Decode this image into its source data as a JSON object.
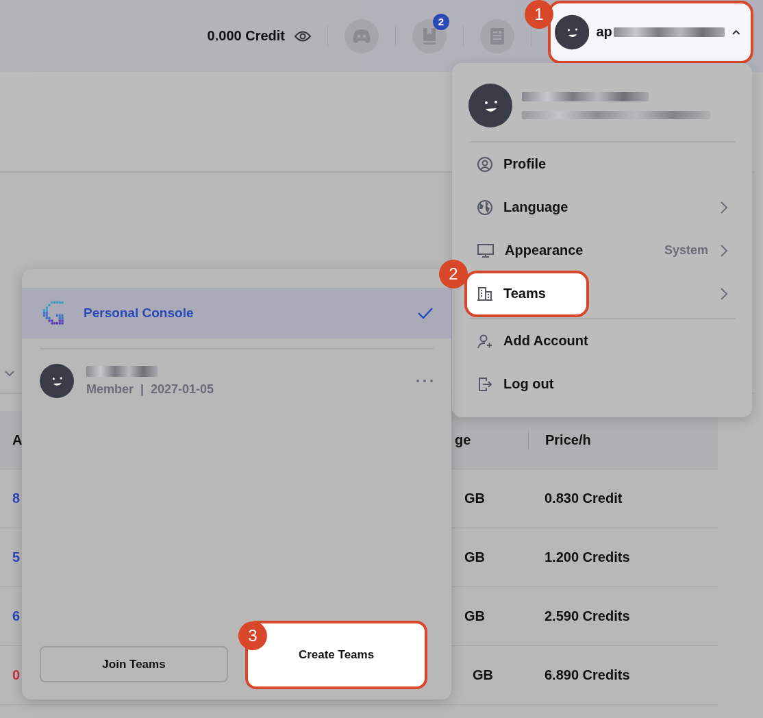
{
  "header": {
    "credit": "0.000 Credit",
    "notification_badge": "2"
  },
  "user_button": {
    "name": "ap",
    "expanded": true,
    "highlighted": true,
    "callout": "1"
  },
  "account_menu": {
    "items": [
      {
        "label": "Profile",
        "submenu": false,
        "highlighted": false,
        "divider_before": false
      },
      {
        "label": "Language",
        "submenu": true,
        "highlighted": false,
        "divider_before": false
      },
      {
        "label": "Appearance",
        "value": "System",
        "submenu": true,
        "highlighted": false,
        "divider_before": false
      },
      {
        "label": "Teams",
        "submenu": true,
        "highlighted": true,
        "callout": "2",
        "divider_before": false
      },
      {
        "label": "Add Account",
        "submenu": false,
        "highlighted": false,
        "divider_before": true
      },
      {
        "label": "Log out",
        "submenu": false,
        "highlighted": false,
        "divider_before": false
      }
    ]
  },
  "teams_panel": {
    "teams": [
      {
        "kind": "console",
        "name": "Personal Console",
        "selected": true
      },
      {
        "kind": "member",
        "subtitle": "Member  |  2027-01-05",
        "selected": false
      }
    ],
    "buttons": [
      {
        "label": "Join Teams",
        "highlighted": false
      },
      {
        "label": "Create Teams",
        "highlighted": true,
        "callout": "3"
      }
    ]
  },
  "table": {
    "columns": [
      "A",
      "ge",
      "Price/h"
    ],
    "rows": [
      {
        "cells": [
          "8",
          "GB",
          "0.830 Credit"
        ],
        "color": "#2b47b8"
      },
      {
        "cells": [
          "5",
          "GB",
          "1.200 Credits"
        ],
        "color": "#2b47b8"
      },
      {
        "cells": [
          "6",
          "GB",
          "2.590 Credits"
        ],
        "color": "#2b47b8"
      },
      {
        "cells": [
          "0",
          "GB",
          "6.890 Credits"
        ],
        "color": "#c8323c"
      }
    ]
  }
}
